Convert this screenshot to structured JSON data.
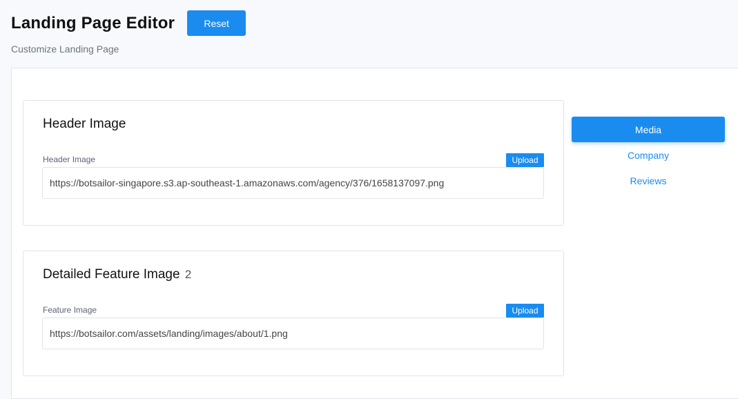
{
  "header": {
    "title": "Landing Page Editor",
    "reset_label": "Reset",
    "subtitle": "Customize Landing Page"
  },
  "cards": [
    {
      "title": "Header Image",
      "title_suffix": "",
      "field_label": "Header Image",
      "upload_label": "Upload",
      "value": "https://botsailor-singapore.s3.ap-southeast-1.amazonaws.com/agency/376/1658137097.png"
    },
    {
      "title": "Detailed Feature Image",
      "title_suffix": "2",
      "field_label": "Feature Image",
      "upload_label": "Upload",
      "value": "https://botsailor.com/assets/landing/images/about/1.png"
    }
  ],
  "side_nav": {
    "items": [
      {
        "label": "Media",
        "active": true
      },
      {
        "label": "Company",
        "active": false
      },
      {
        "label": "Reviews",
        "active": false
      }
    ]
  },
  "colors": {
    "accent": "#1a8cf0",
    "background": "#f7f9fc",
    "border": "#dfe3ea"
  }
}
